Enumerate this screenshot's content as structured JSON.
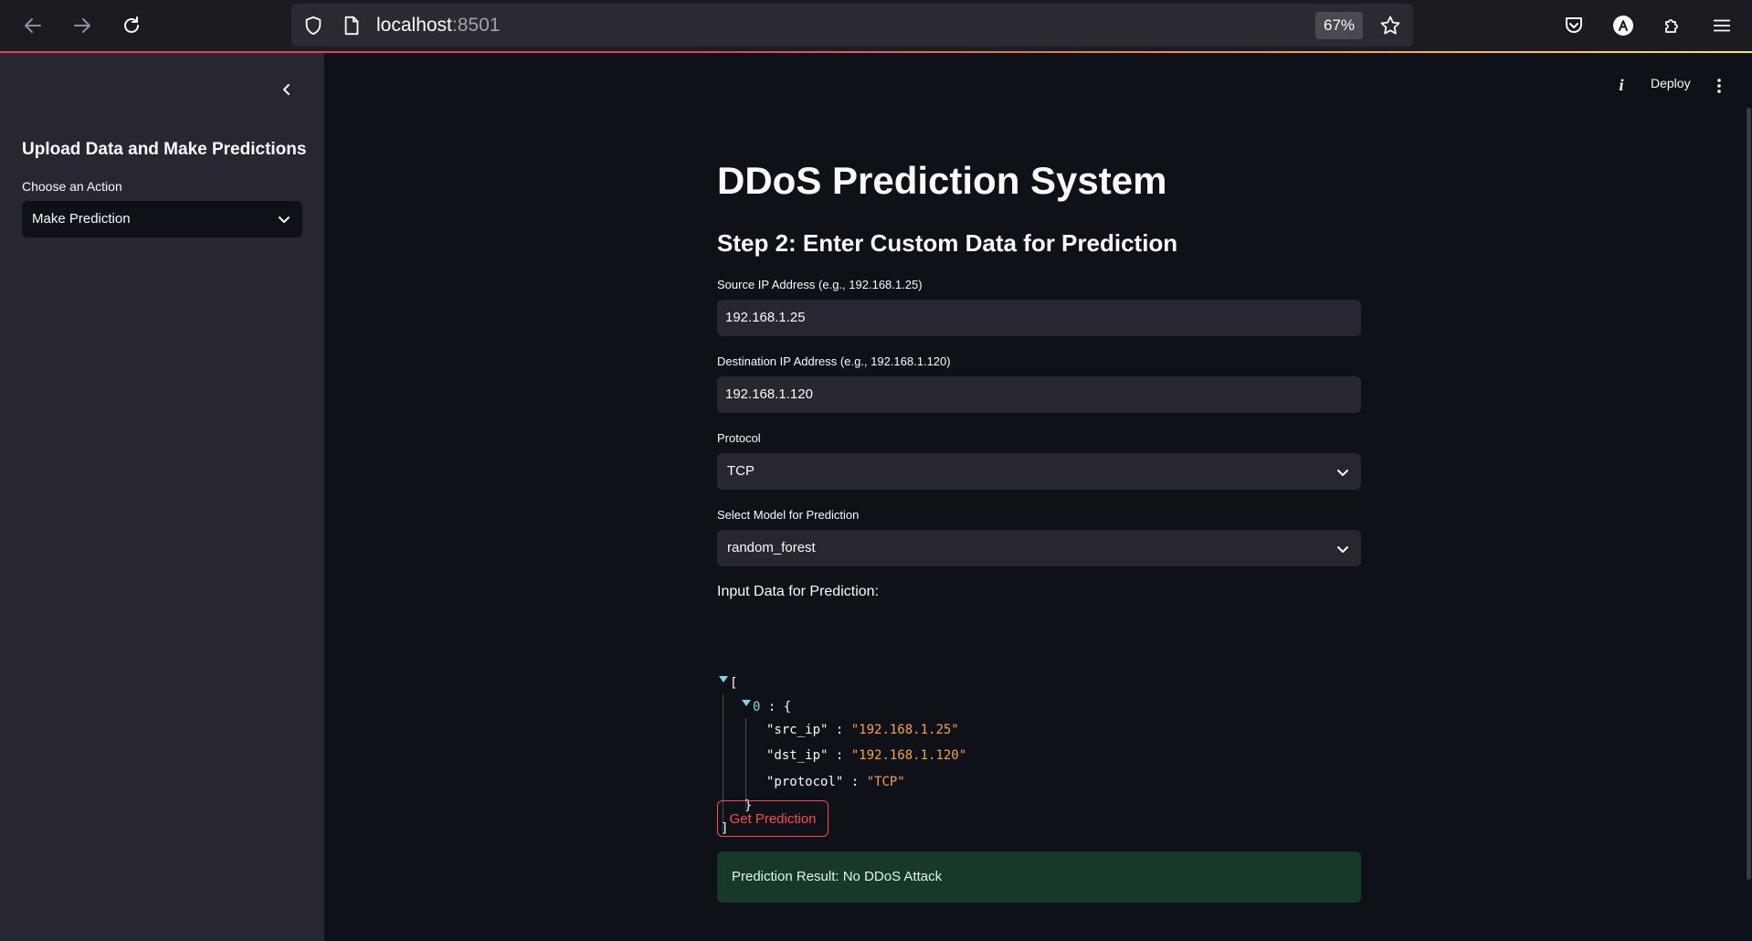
{
  "browser": {
    "url_host": "localhost",
    "url_port": ":8501",
    "zoom": "67%"
  },
  "sidebar": {
    "title": "Upload Data and Make Predictions",
    "action_label": "Choose an Action",
    "action_value": "Make Prediction"
  },
  "header": {
    "deploy_label": "Deploy"
  },
  "main": {
    "title": "DDoS Prediction System",
    "step_heading": "Step 2: Enter Custom Data for Prediction",
    "src_ip_label": "Source IP Address (e.g., 192.168.1.25)",
    "src_ip_value": "192.168.1.25",
    "dst_ip_label": "Destination IP Address (e.g., 192.168.1.120)",
    "dst_ip_value": "192.168.1.120",
    "protocol_label": "Protocol",
    "protocol_value": "TCP",
    "model_label": "Select Model for Prediction",
    "model_value": "random_forest",
    "json_label": "Input Data for Prediction:",
    "json": {
      "open_bracket": "[",
      "index": "0",
      "colon_brace": " : {",
      "rows": [
        {
          "key": "\"src_ip\"",
          "sep": " : ",
          "value": "\"192.168.1.25\""
        },
        {
          "key": "\"dst_ip\"",
          "sep": " : ",
          "value": "\"192.168.1.120\""
        },
        {
          "key": "\"protocol\"",
          "sep": " : ",
          "value": "\"TCP\""
        }
      ],
      "close_brace": "}",
      "close_bracket": "]"
    },
    "predict_button": "Get Prediction",
    "result_text": "Prediction Result: No DDoS Attack"
  }
}
